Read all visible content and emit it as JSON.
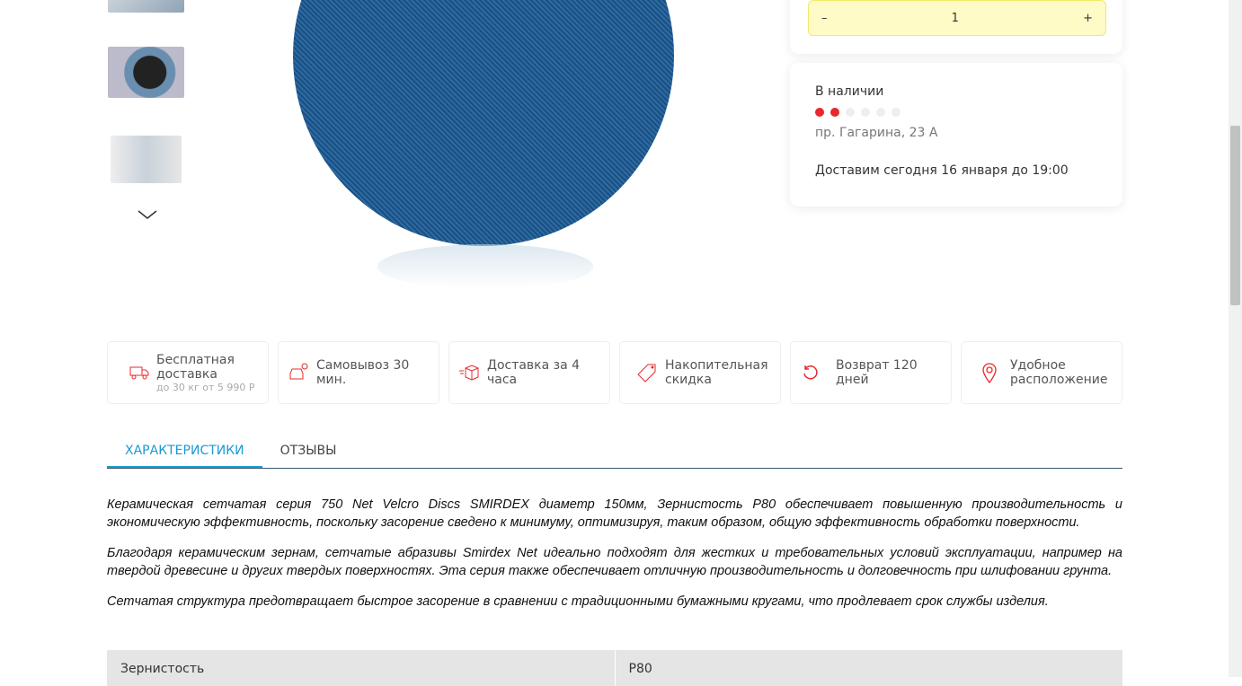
{
  "gallery": {
    "thumbnails": [
      "thumb-1",
      "thumb-2",
      "thumb-3"
    ]
  },
  "quantity": {
    "minus": "–",
    "value": "1",
    "plus": "+"
  },
  "availability": {
    "status": "В наличии",
    "stock_level": 2,
    "stock_max": 6,
    "address": "пр. Гагарина, 23 А",
    "delivery": "Доставим сегодня 16 января до 19:00",
    "accent": "#e8282d"
  },
  "features": [
    {
      "icon": "truck-free-icon",
      "title": "Бесплатная доставка",
      "sub": "до 30 кг от 5 990 Р"
    },
    {
      "icon": "car-pin-icon",
      "title": "Самовывоз 30 мин."
    },
    {
      "icon": "box-fast-icon",
      "title": "Доставка за 4 часа"
    },
    {
      "icon": "discount-tag-icon",
      "title": "Накопительная скидка"
    },
    {
      "icon": "return-icon",
      "title": "Возврат 120 дней"
    },
    {
      "icon": "location-pin-icon",
      "title": "Удобное расположение"
    }
  ],
  "tabs": [
    {
      "label": "ХАРАКТЕРИСТИКИ",
      "active": true
    },
    {
      "label": "ОТЗЫВЫ"
    }
  ],
  "description": [
    "Керамическая сетчатая серия 750 Net Velcro Discs SMIRDEX диаметр 150мм, Зернистость P80 обеспечивает  повышенную производительность и экономическую эффективность, поскольку засорение сведено к минимуму, оптимизируя, таким образом, общую эффективность обработки поверхности.",
    "Благодаря керамическим зернам, сетчатые абразивы Smirdex Net идеально подходят для жестких и требовательных условий эксплуатации, например на твердой древесине и других твердых поверхностях. Эта серия также обеспечивает отличную производительность и долговечность при шлифовании грунта.",
    "Сетчатая структура предотвращает быстрое засорение в сравнении с традиционными бумажными кругами, что продлевает срок службы изделия."
  ],
  "specs": [
    {
      "name": "Зернистость",
      "value": "P80"
    }
  ]
}
